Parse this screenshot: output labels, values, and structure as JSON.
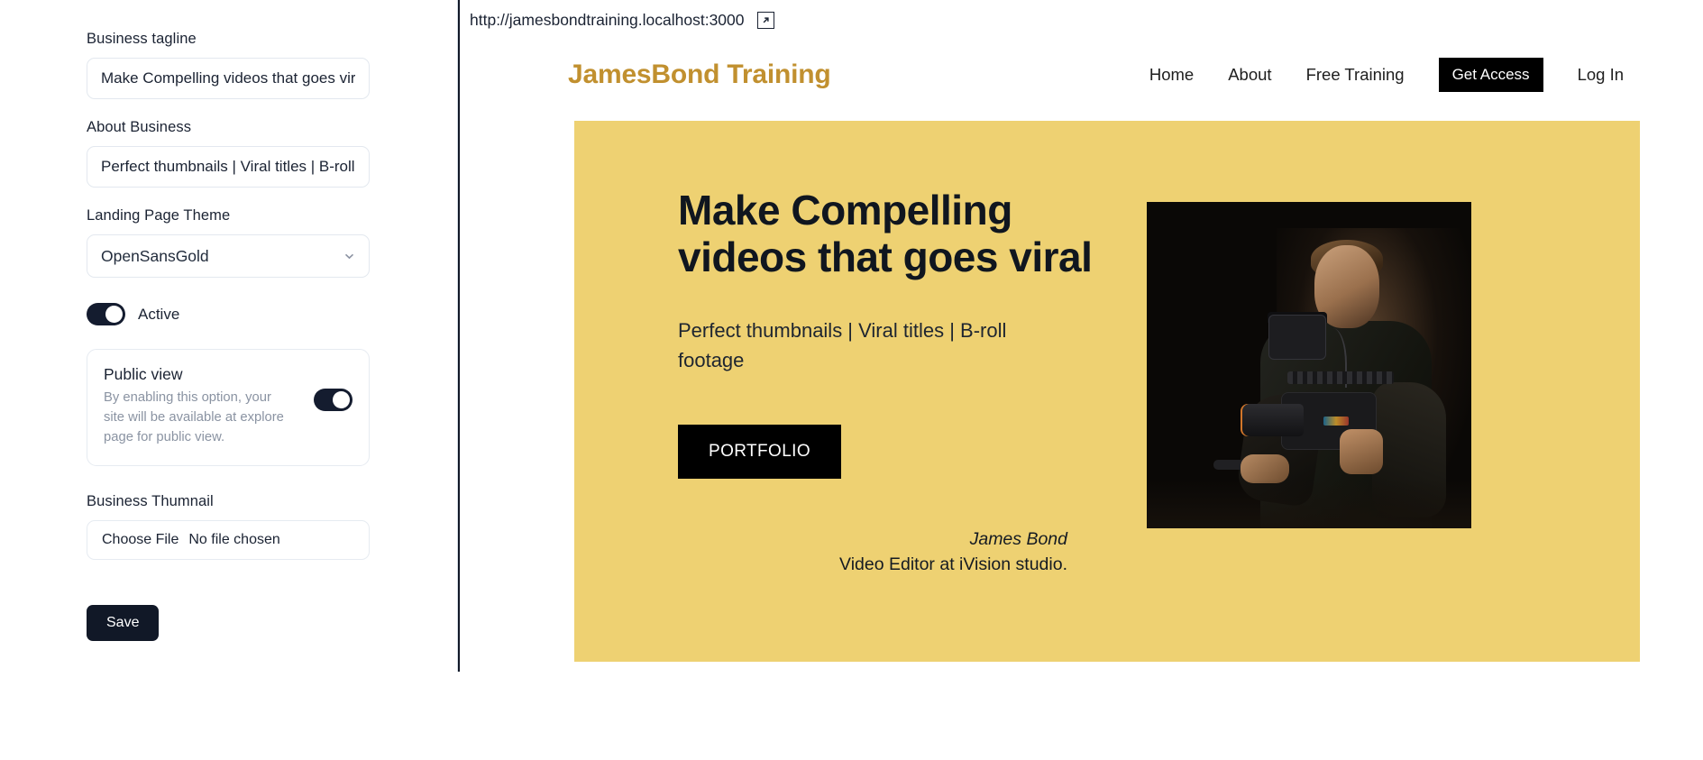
{
  "editor": {
    "fields": [
      {
        "label": "Business tagline",
        "value": "Make Compelling videos that goes vira",
        "placeholder": "Business tagline"
      },
      {
        "label": "About Business",
        "value": "Perfect thumbnails | Viral titles | B-roll f",
        "placeholder": "About Business"
      }
    ],
    "theme": {
      "label": "Landing Page Theme",
      "selected": "OpenSansGold",
      "options": [
        "OpenSansGold"
      ],
      "chevron_icon": "chevron-down-icon"
    },
    "active_toggle": {
      "label": "Active",
      "state": "on"
    },
    "public_view": {
      "title": "Public view",
      "description": "By enabling this option, your site will be available at explore page for public view.",
      "state": "on"
    },
    "thumbnail": {
      "label": "Business Thumnail",
      "button_label": "Choose File",
      "status": "No file chosen"
    },
    "save_label": "Save"
  },
  "preview": {
    "url": "http://jamesbondtraining.localhost:3000",
    "open_icon": "external-link-icon",
    "site": {
      "brand": "JamesBond Training",
      "brand_color": "#c1902f",
      "nav": [
        {
          "label": "Home",
          "type": "link"
        },
        {
          "label": "About",
          "type": "link"
        },
        {
          "label": "Free Training",
          "type": "link"
        },
        {
          "label": "Get Access",
          "type": "button"
        },
        {
          "label": "Log In",
          "type": "link"
        }
      ],
      "hero": {
        "background_color": "#eed172",
        "title": "Make Compelling\nvideos that goes viral",
        "subtitle": "Perfect thumbnails | Viral titles | B-roll footage",
        "cta_label": "PORTFOLIO",
        "author_name": "James Bond",
        "author_role": "Video Editor at iVision studio.",
        "photo_alt": "videographer-photo"
      }
    }
  }
}
